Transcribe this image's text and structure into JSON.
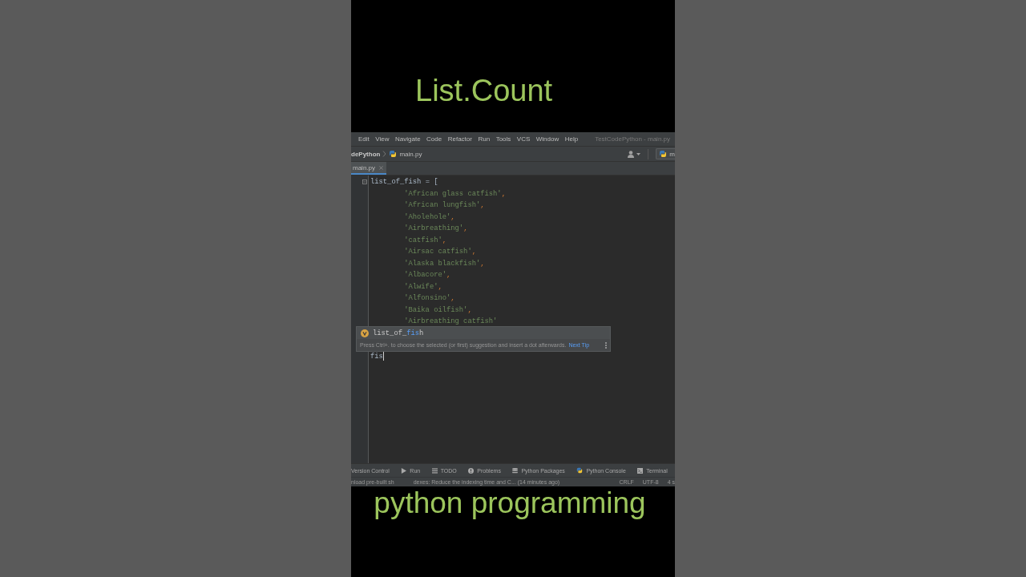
{
  "title": "List.Count",
  "ide": {
    "menu": [
      "Edit",
      "View",
      "Navigate",
      "Code",
      "Refactor",
      "Run",
      "Tools",
      "VCS",
      "Window",
      "Help"
    ],
    "window_title": "TestCodePython - main.py",
    "breadcrumbs": {
      "project": "dePython",
      "file": "main.py"
    },
    "run_config": "m",
    "tabs": [
      {
        "label": "main.py",
        "selected": true
      }
    ],
    "editor": {
      "lines": [
        {
          "kind": "assignment",
          "text": "list_of_fish = ["
        },
        {
          "kind": "item",
          "text": "'African glass catfish'",
          "punct": ","
        },
        {
          "kind": "item",
          "text": "'African lungfish'",
          "punct": ","
        },
        {
          "kind": "item",
          "text": "'Aholehole'",
          "punct": ","
        },
        {
          "kind": "item",
          "text": "'Airbreathing'",
          "punct": ","
        },
        {
          "kind": "item",
          "text": "'catfish'",
          "punct": ","
        },
        {
          "kind": "item",
          "text": "'Airsac catfish'",
          "punct": ","
        },
        {
          "kind": "item",
          "text": "'Alaska blackfish'",
          "punct": ","
        },
        {
          "kind": "item",
          "text": "'Albacore'",
          "punct": ","
        },
        {
          "kind": "item",
          "text": "'Alwife'",
          "punct": ","
        },
        {
          "kind": "item",
          "text": "'Alfonsino'",
          "punct": ","
        },
        {
          "kind": "item",
          "text": "'Baika oilfish'",
          "punct": ","
        },
        {
          "kind": "item",
          "text": "'Airbreathing catfish'"
        }
      ],
      "completion": {
        "before": "list_of_",
        "match": "fis",
        "after": "h",
        "hint": "Press Ctrl+. to choose the selected (or first) suggestion and insert a dot afterwards.",
        "link": "Next Tip"
      },
      "typed_line": "fis"
    },
    "tool_windows": [
      "Version Control",
      "Run",
      "TODO",
      "Problems",
      "Python Packages",
      "Python Console",
      "Terminal"
    ],
    "status_bar": {
      "message": [
        "nload pre-built sh",
        "dexes: Reduce the indexing time and C... (14 minutes ago)"
      ],
      "indicators": [
        "CRLF",
        "UTF-8",
        "4 s"
      ]
    }
  },
  "caption": "python programming"
}
